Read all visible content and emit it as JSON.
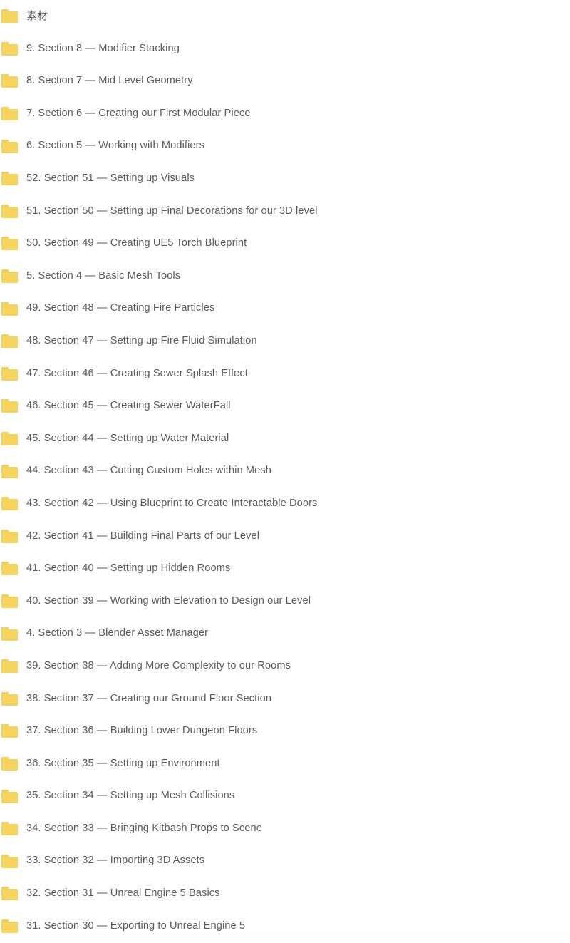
{
  "view": {
    "background_color": "#ffffff",
    "text_color": "#5a5a5a",
    "folder_color": "#f5d45e",
    "folder_tab_color": "#f2cf5a"
  },
  "folder_list": {
    "icon_name": "folder-icon",
    "items": [
      {
        "label": "素材",
        "is_cjk": true
      },
      {
        "label": "9. Section 8 — Modifier Stacking",
        "is_cjk": false
      },
      {
        "label": "8. Section 7 — Mid Level Geometry",
        "is_cjk": false
      },
      {
        "label": "7. Section 6 — Creating our First Modular Piece",
        "is_cjk": false
      },
      {
        "label": "6. Section 5 — Working with Modifiers",
        "is_cjk": false
      },
      {
        "label": "52. Section 51 — Setting up Visuals",
        "is_cjk": false
      },
      {
        "label": "51. Section 50 — Setting up Final Decorations for our 3D level",
        "is_cjk": false
      },
      {
        "label": "50. Section 49 — Creating UE5 Torch Blueprint",
        "is_cjk": false
      },
      {
        "label": "5. Section 4 — Basic Mesh Tools",
        "is_cjk": false
      },
      {
        "label": "49. Section 48 — Creating Fire Particles",
        "is_cjk": false
      },
      {
        "label": "48. Section 47 — Setting up Fire Fluid Simulation",
        "is_cjk": false
      },
      {
        "label": "47. Section 46 — Creating Sewer Splash Effect",
        "is_cjk": false
      },
      {
        "label": "46. Section 45 — Creating Sewer WaterFall",
        "is_cjk": false
      },
      {
        "label": "45. Section 44 — Setting up Water Material",
        "is_cjk": false
      },
      {
        "label": "44. Section 43 — Cutting Custom Holes within Mesh",
        "is_cjk": false
      },
      {
        "label": "43. Section 42 — Using Blueprint to Create Interactable Doors",
        "is_cjk": false
      },
      {
        "label": "42. Section 41 — Building Final Parts of our Level",
        "is_cjk": false
      },
      {
        "label": "41. Section 40 — Setting up Hidden Rooms",
        "is_cjk": false
      },
      {
        "label": "40. Section 39 — Working with Elevation to Design our Level",
        "is_cjk": false
      },
      {
        "label": "4. Section 3 — Blender Asset Manager",
        "is_cjk": false
      },
      {
        "label": "39. Section 38 — Adding More Complexity to our Rooms",
        "is_cjk": false
      },
      {
        "label": "38. Section 37 — Creating our Ground Floor Section",
        "is_cjk": false
      },
      {
        "label": "37. Section 36 — Building Lower Dungeon Floors",
        "is_cjk": false
      },
      {
        "label": "36. Section 35 — Setting up Environment",
        "is_cjk": false
      },
      {
        "label": "35. Section 34 — Setting up Mesh Collisions",
        "is_cjk": false
      },
      {
        "label": "34. Section 33 — Bringing Kitbash Props to Scene",
        "is_cjk": false
      },
      {
        "label": "33. Section 32 — Importing 3D Assets",
        "is_cjk": false
      },
      {
        "label": "32. Section 31 — Unreal Engine 5 Basics",
        "is_cjk": false
      },
      {
        "label": "31. Section 30 — Exporting to Unreal Engine 5",
        "is_cjk": false
      }
    ]
  }
}
